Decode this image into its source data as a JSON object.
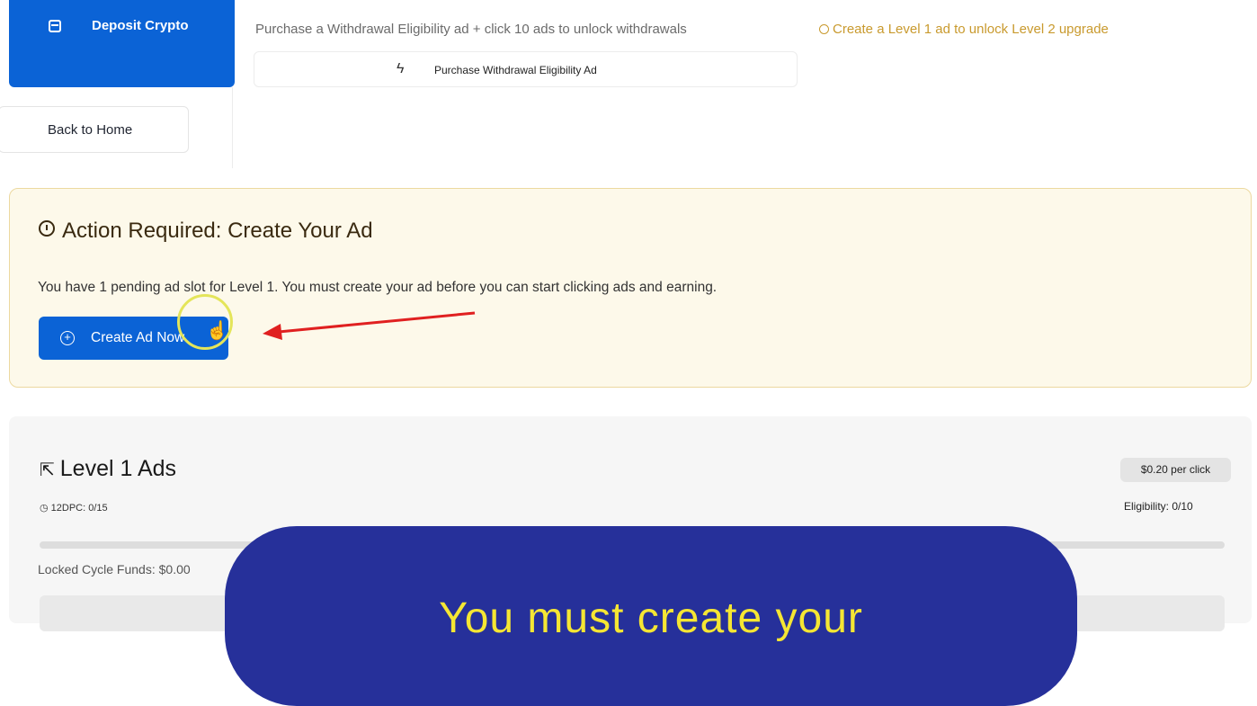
{
  "sidebar": {
    "deposit_label": "Deposit Crypto",
    "back_label": "Back to Home"
  },
  "withdrawal": {
    "info": "Purchase a Withdrawal Eligibility ad + click 10 ads to unlock withdrawals",
    "warning": "Create a Level 1 ad to unlock Level 2 upgrade",
    "purchase_label": "Purchase Withdrawal Eligibility Ad"
  },
  "action": {
    "title": "Action Required: Create Your Ad",
    "description": "You have 1 pending ad slot for Level 1. You must create your ad before you can start clicking ads and earning.",
    "button_label": "Create Ad Now"
  },
  "level": {
    "title": "Level 1 Ads",
    "dpc": "12DPC: 0/15",
    "price": "$0.20 per click",
    "eligibility": "Eligibility: 0/10",
    "progress": 0,
    "locked_funds": "Locked Cycle Funds: $0.00"
  },
  "overlay": {
    "text": "You must create your"
  },
  "colors": {
    "primary": "#0b63d6",
    "warning": "#c99a2e",
    "panel_bg": "#fdf9ea",
    "overlay_bg": "#26309a",
    "overlay_text": "#f5e633",
    "arrow": "#e02020"
  }
}
